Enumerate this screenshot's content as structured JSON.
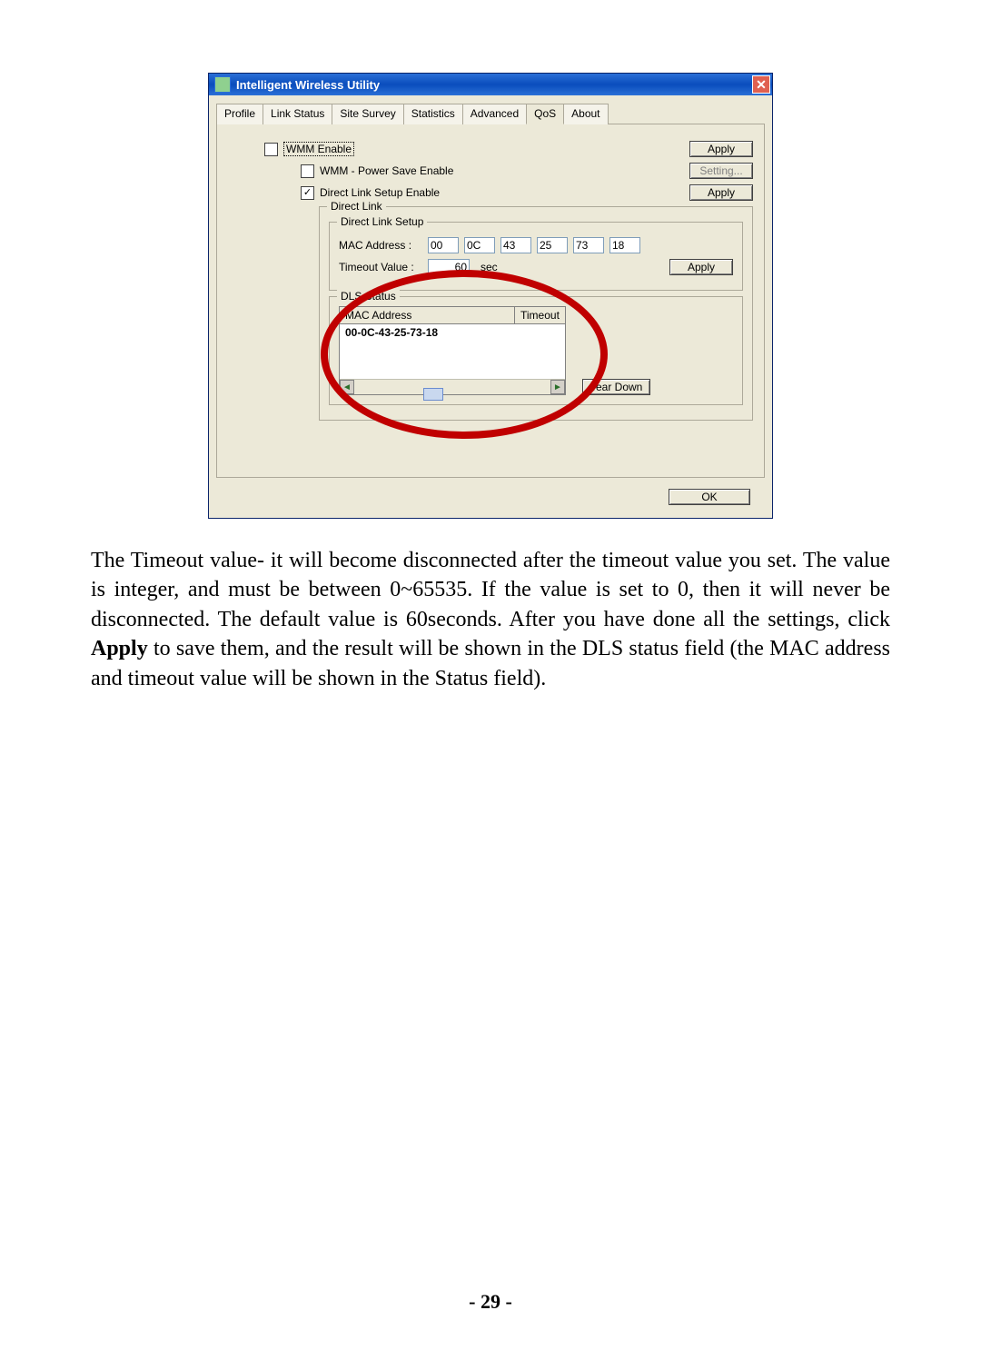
{
  "window": {
    "title": "Intelligent Wireless Utility",
    "close_glyph": "✕"
  },
  "tabs": [
    "Profile",
    "Link Status",
    "Site Survey",
    "Statistics",
    "Advanced",
    "QoS",
    "About"
  ],
  "active_tab_index": 5,
  "qos": {
    "wmm_enable_label": "WMM Enable",
    "wmm_enable_checked": false,
    "apply1": "Apply",
    "wmm_ps_label": "WMM - Power Save Enable",
    "wmm_ps_checked": false,
    "setting_btn": "Setting...",
    "dls_enable_label": "Direct Link Setup Enable",
    "dls_enable_checked": true,
    "apply2": "Apply",
    "direct_link_group": "Direct Link",
    "direct_link_setup_group": "Direct Link Setup",
    "mac_label": "MAC Address :",
    "mac": [
      "00",
      "0C",
      "43",
      "25",
      "73",
      "18"
    ],
    "tv_label": "Timeout Value :",
    "tv_value": "60",
    "tv_unit": "sec",
    "apply3": "Apply",
    "dls_status_group": "DLS Status",
    "dls_headers": {
      "mac": "MAC Address",
      "timeout": "Timeout"
    },
    "dls_entry": "00-0C-43-25-73-18",
    "tear_down": "Tear Down",
    "ok": "OK"
  },
  "paragraph": "The Timeout value- it will become disconnected after the timeout value you set. The value is integer, and must be between 0~65535. If the value is set to 0, then it will never be disconnected. The default value is 60seconds. After you have done all the settings, click ",
  "paragraph_bold": "Apply",
  "paragraph_rest": " to save them, and the result will be shown in the DLS status field (the MAC address and timeout value will be shown in the Status field).",
  "page_number": "- 29 -"
}
